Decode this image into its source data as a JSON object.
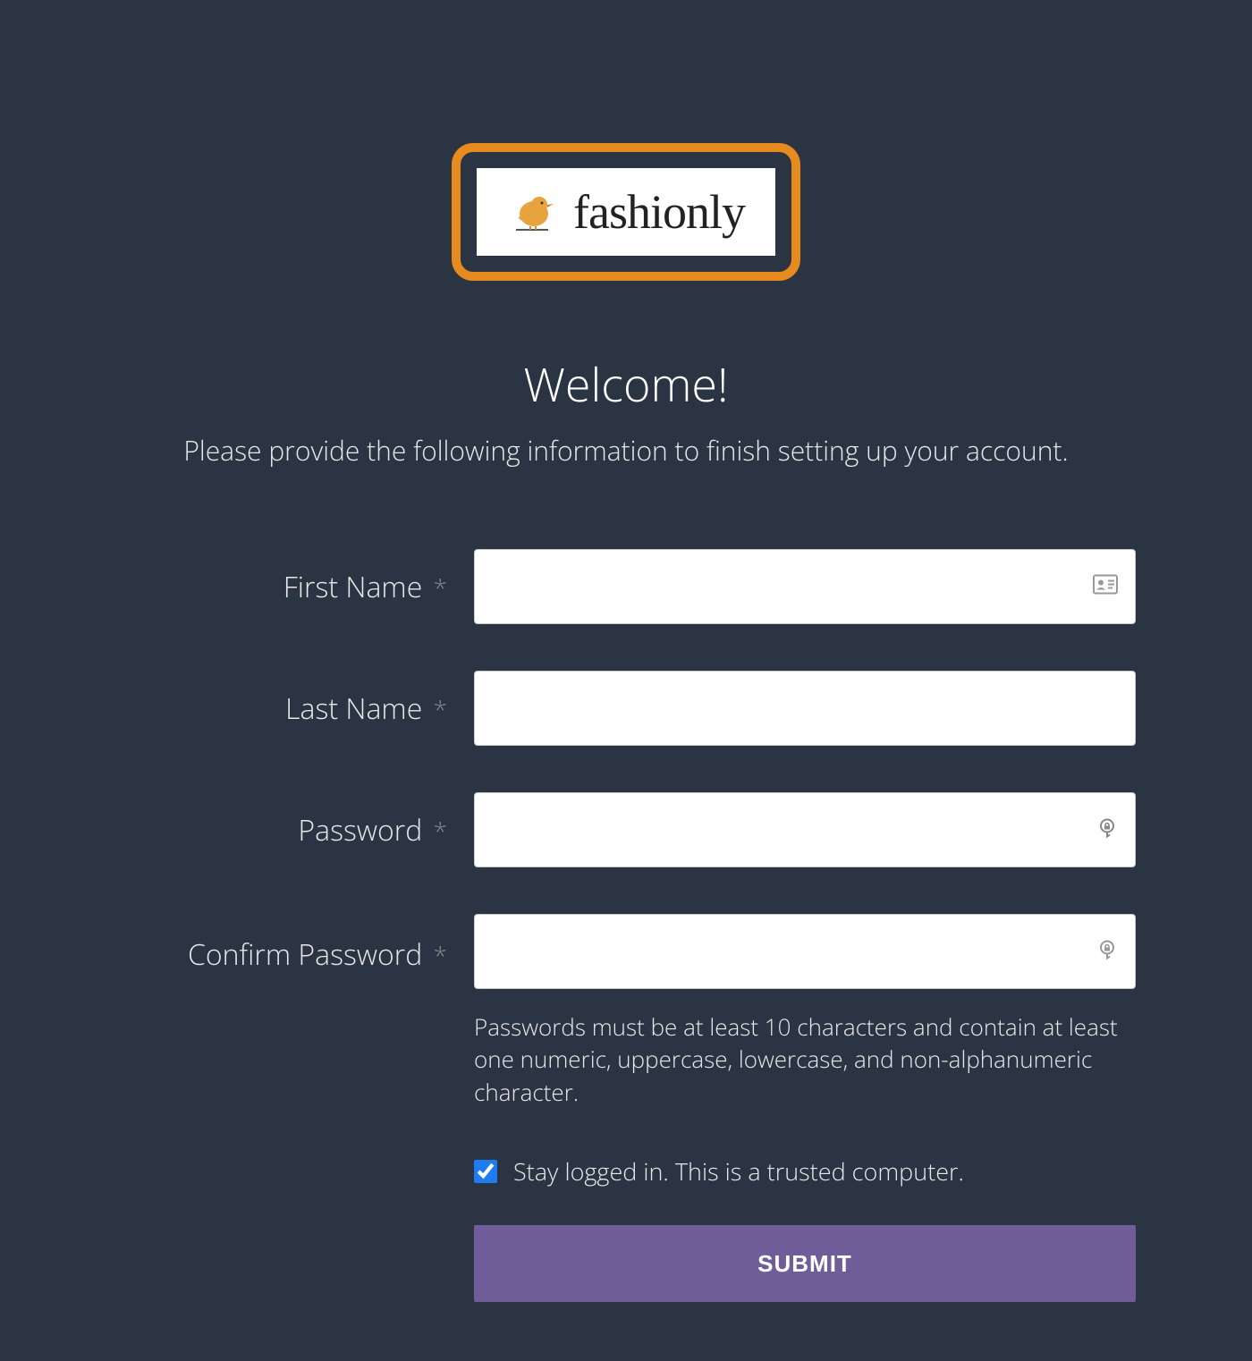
{
  "logo": {
    "brand_name": "fashionly",
    "icon_name": "bird-icon"
  },
  "heading": "Welcome!",
  "subheading": "Please provide the following information to finish setting up your account.",
  "fields": {
    "first_name": {
      "label": "First Name",
      "required": "*",
      "value": ""
    },
    "last_name": {
      "label": "Last Name",
      "required": "*",
      "value": ""
    },
    "password": {
      "label": "Password",
      "required": "*",
      "value": ""
    },
    "confirm_password": {
      "label": "Confirm Password",
      "required": "*",
      "value": ""
    }
  },
  "password_helper": "Passwords must be at least 10 characters and contain at least one numeric, uppercase, lowercase, and non-alphanumeric character.",
  "stay_logged_in": {
    "label": "Stay logged in. This is a trusted computer.",
    "checked": true
  },
  "submit_label": "SUBMIT"
}
